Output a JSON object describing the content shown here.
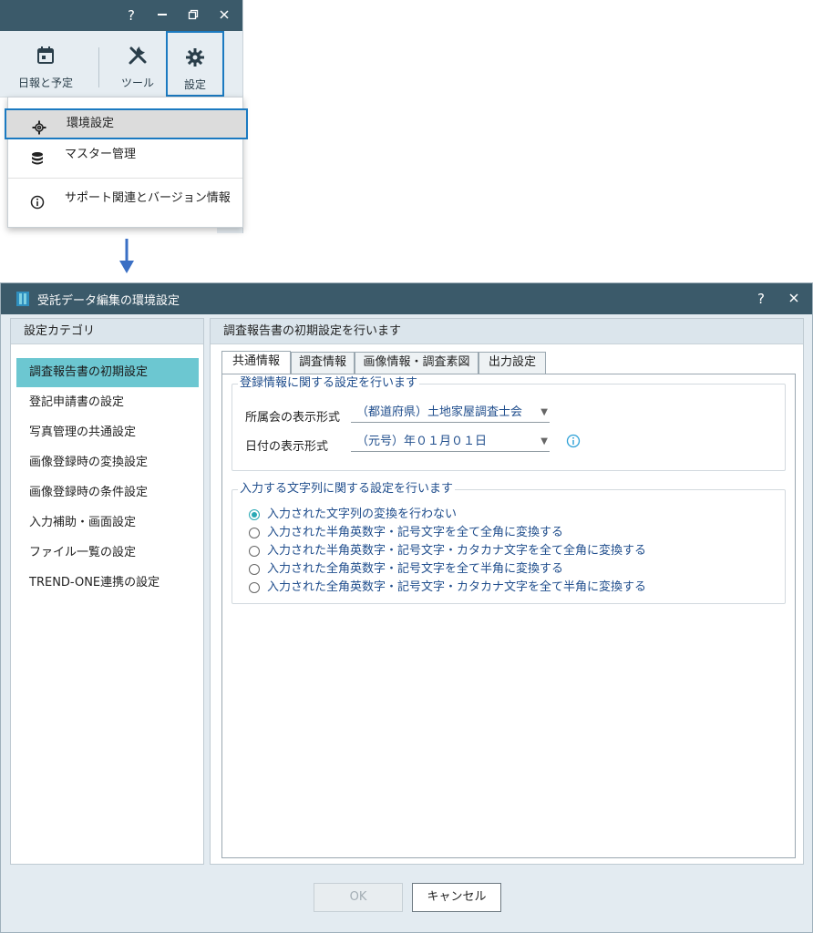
{
  "top_window": {
    "help_label": "?",
    "ribbon": {
      "daily_report_label": "日報と予定",
      "tools_label": "ツール",
      "settings_label": "設定"
    },
    "menu": {
      "items": [
        {
          "label": "環境設定",
          "icon": "gear-small-icon"
        },
        {
          "label": "マスター管理",
          "icon": "database-icon"
        },
        {
          "label": "サポート関連とバージョン情報",
          "icon": "info-icon"
        }
      ]
    }
  },
  "dialog": {
    "title": "受託データ編集の環境設定",
    "help_label": "?",
    "category_header": "設定カテゴリ",
    "categories": [
      "調査報告書の初期設定",
      "登記申請書の設定",
      "写真管理の共通設定",
      "画像登録時の変換設定",
      "画像登録時の条件設定",
      "入力補助・画面設定",
      "ファイル一覧の設定",
      "TREND-ONE連携の設定"
    ],
    "main_header": "調査報告書の初期設定を行います",
    "tabs": [
      "共通情報",
      "調査情報",
      "画像情報・調査素図",
      "出力設定"
    ],
    "registration_group": {
      "title": "登録情報に関する設定を行います",
      "affiliation_label": "所属会の表示形式",
      "affiliation_value": "（都道府県）土地家屋調査士会",
      "date_label": "日付の表示形式",
      "date_value": "（元号）年０１月０１日"
    },
    "string_group": {
      "title": "入力する文字列に関する設定を行います",
      "options": [
        "入力された文字列の変換を行わない",
        "入力された半角英数字・記号文字を全て全角に変換する",
        "入力された半角英数字・記号文字・カタカナ文字を全て全角に変換する",
        "入力された全角英数字・記号文字を全て半角に変換する",
        "入力された全角英数字・記号文字・カタカナ文字を全て半角に変換する"
      ],
      "selected_index": 0
    },
    "ok_label": "OK",
    "cancel_label": "キャンセル"
  },
  "colors": {
    "titlebar": "#3b5a6a",
    "highlight_border": "#1b7ac1",
    "selected_category": "#6cc7d1",
    "link_text": "#1f4d8c"
  }
}
